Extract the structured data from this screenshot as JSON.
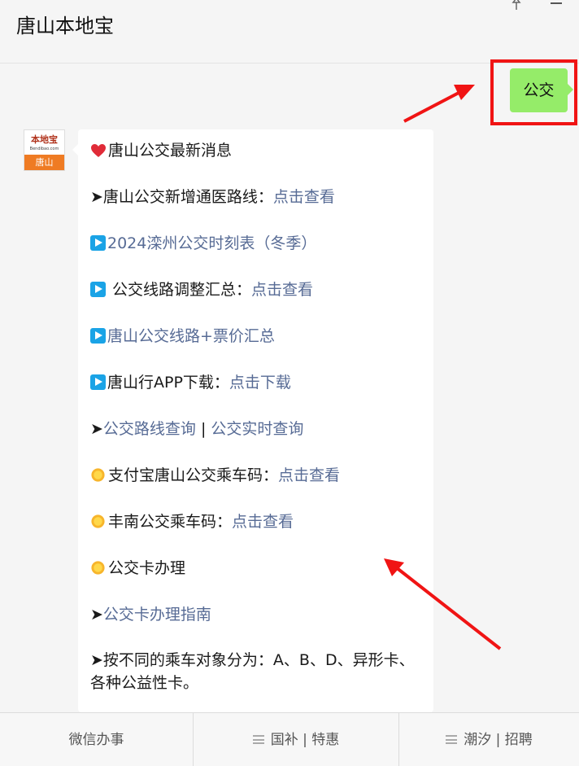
{
  "header": {
    "title": "唐山本地宝"
  },
  "sent": {
    "text": "公交"
  },
  "avatar": {
    "logo": "本地宝",
    "domain": "Bendibao.com",
    "city": "唐山"
  },
  "message": {
    "l1": {
      "text": "唐山公交最新消息"
    },
    "l2": {
      "prefix": "➤唐山公交新增通医路线：",
      "link": "点击查看"
    },
    "l3": {
      "link": "2024滦州公交时刻表（冬季）"
    },
    "l4": {
      "prefix": " 公交线路调整汇总：",
      "link": "点击查看"
    },
    "l5": {
      "link": "唐山公交线路+票价汇总"
    },
    "l6": {
      "prefix": "唐山行APP下载：",
      "link": "点击下载"
    },
    "l7": {
      "prefix": "➤",
      "link1": "公交路线查询",
      "sep": " | ",
      "link2": "公交实时查询"
    },
    "l8": {
      "prefix": "支付宝唐山公交乘车码：",
      "link": "点击查看"
    },
    "l9": {
      "prefix": "丰南公交乘车码：",
      "link": "点击查看"
    },
    "l10": {
      "text": "公交卡办理"
    },
    "l11": {
      "prefix": "➤",
      "link": "公交卡办理指南"
    },
    "l12": {
      "text": "➤按不同的乘车对象分为：A、B、D、异形卡、各种公益性卡。"
    }
  },
  "menu": {
    "items": [
      {
        "label": "微信办事"
      },
      {
        "label": "国补 | 特惠"
      },
      {
        "label": "潮汐 | 招聘"
      }
    ]
  },
  "colors": {
    "link": "#576b95",
    "sent_bubble": "#95ec69",
    "highlight": "#f01414"
  }
}
